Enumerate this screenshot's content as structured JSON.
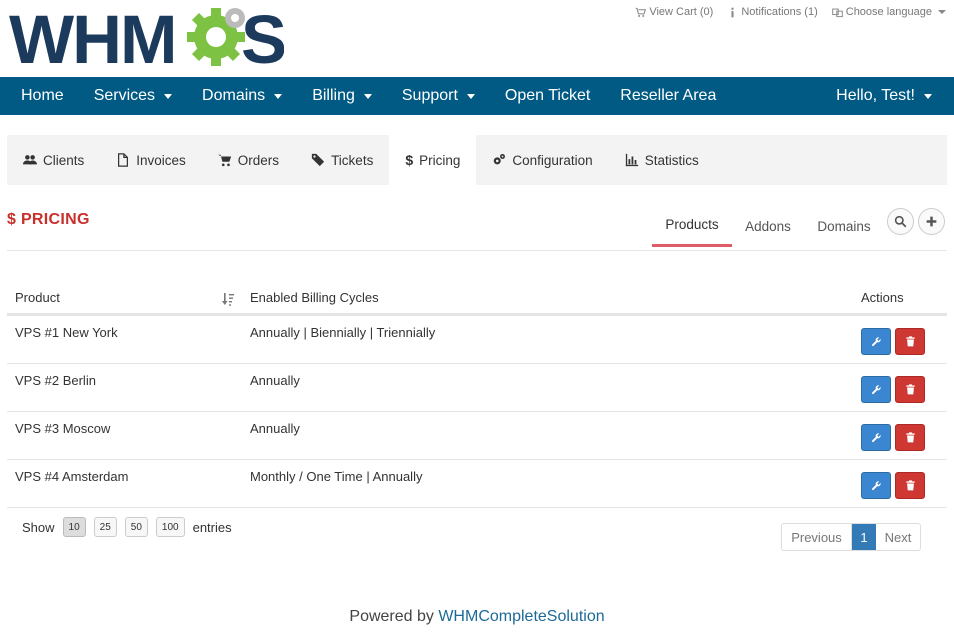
{
  "header": {
    "logo_text": "WHMCS",
    "view_cart": "View Cart (0)",
    "notifications": "Notifications (1)",
    "choose_language": "Choose language"
  },
  "main_nav": {
    "items": [
      {
        "label": "Home"
      },
      {
        "label": "Services"
      },
      {
        "label": "Domains"
      },
      {
        "label": "Billing"
      },
      {
        "label": "Support"
      },
      {
        "label": "Open Ticket"
      },
      {
        "label": "Reseller Area"
      }
    ],
    "user": "Hello, Test!"
  },
  "sub_nav": {
    "items": [
      {
        "label": "Clients",
        "icon": "users-icon"
      },
      {
        "label": "Invoices",
        "icon": "file-icon"
      },
      {
        "label": "Orders",
        "icon": "cart-icon"
      },
      {
        "label": "Tickets",
        "icon": "ticket-icon"
      },
      {
        "label": "Pricing",
        "icon": "dollar-icon"
      },
      {
        "label": "Configuration",
        "icon": "cogs-icon"
      },
      {
        "label": "Statistics",
        "icon": "bar-chart-icon"
      }
    ],
    "active": "Pricing"
  },
  "page": {
    "title_icon": "$",
    "title": "PRICING",
    "tabs": [
      {
        "label": "Products",
        "active": true
      },
      {
        "label": "Addons"
      },
      {
        "label": "Domains"
      }
    ]
  },
  "table": {
    "headers": {
      "product": "Product",
      "cycles": "Enabled Billing Cycles",
      "actions": "Actions"
    },
    "rows": [
      {
        "product": "VPS #1 New York",
        "cycles": "Annually | Biennially | Triennially"
      },
      {
        "product": "VPS #2 Berlin",
        "cycles": "Annually"
      },
      {
        "product": "VPS #3 Moscow",
        "cycles": "Annually"
      },
      {
        "product": "VPS #4 Amsterdam",
        "cycles": "Monthly / One Time | Annually"
      }
    ]
  },
  "footer_controls": {
    "show_label": "Show",
    "page_sizes": [
      "10",
      "25",
      "50",
      "100"
    ],
    "selected_size": "10",
    "entries_label": "entries",
    "previous": "Previous",
    "current_page": "1",
    "next": "Next"
  },
  "powered": {
    "prefix": "Powered by ",
    "link": "WHMCompleteSolution"
  },
  "colors": {
    "nav_bg": "#005a84",
    "title_red": "#c9302c",
    "tab_underline": "#e05c66",
    "edit_blue": "#3b86d0",
    "delete_red": "#cf3733",
    "logo_navy": "#1b3a5c",
    "logo_green": "#7dc242"
  }
}
